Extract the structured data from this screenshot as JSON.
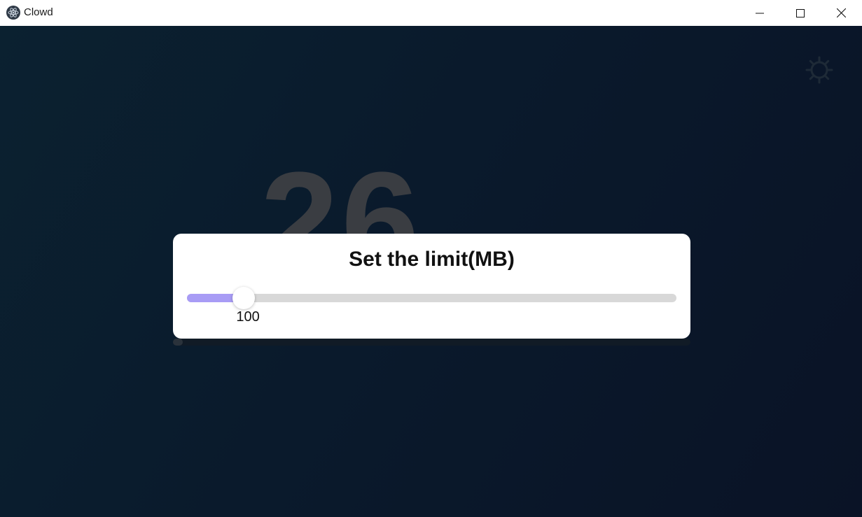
{
  "window": {
    "title": "Clowd",
    "icons": {
      "app": "electron-atom-icon",
      "minimize": "minimize-icon",
      "maximize": "maximize-icon",
      "close": "close-icon"
    }
  },
  "main": {
    "settings_icon": "gear-icon",
    "background_number": "26",
    "colors": {
      "background_start": "#0b2130",
      "background_end": "#0a1326",
      "number_color": "#3a3d42"
    }
  },
  "modal": {
    "title": "Set the limit(MB)",
    "slider": {
      "value": "100",
      "fraction": 0.116,
      "fill_color": "#a89cf5",
      "track_color": "#d8d8d8"
    }
  }
}
